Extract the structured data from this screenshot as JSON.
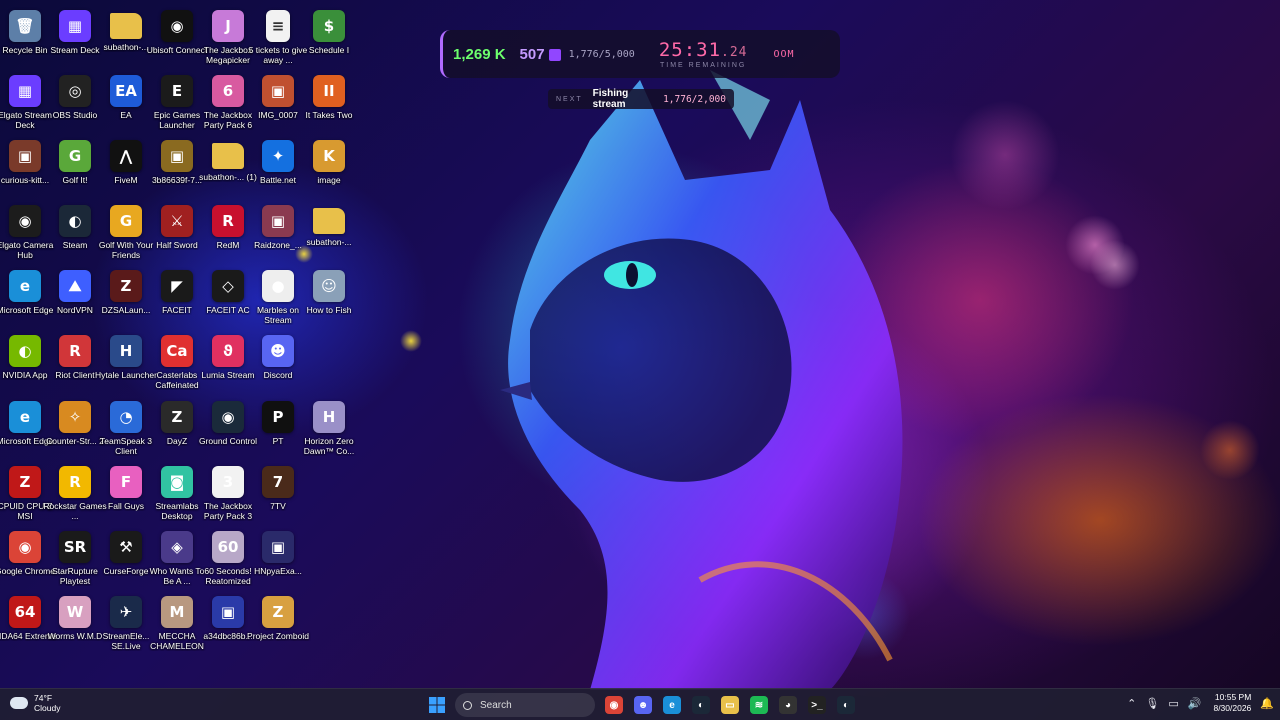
{
  "desktop": {
    "icons": [
      {
        "label": "Recycle Bin",
        "icon": "recycle-bin-icon",
        "color": "#5d7fa8",
        "glyph": "🗑"
      },
      {
        "label": "Stream Deck",
        "icon": "stream-deck-icon",
        "color": "#6b3dff",
        "glyph": "▦"
      },
      {
        "label": "subathon-...",
        "icon": "folder-icon",
        "color": "#e8c04a",
        "glyph": ""
      },
      {
        "label": "Ubisoft Connect",
        "icon": "ubisoft-icon",
        "color": "#111111",
        "glyph": "◉"
      },
      {
        "label": "The Jackbox Megapicker",
        "icon": "jackbox-icon",
        "color": "#c77ad8",
        "glyph": "J"
      },
      {
        "label": "5 tickets to give away ...",
        "icon": "text-file-icon",
        "color": "#f2f2f2",
        "glyph": "≡"
      },
      {
        "label": "Schedule I",
        "icon": "schedule-i-icon",
        "color": "#3a8f3a",
        "glyph": "$"
      },
      {
        "label": "Elgato Stream Deck",
        "icon": "stream-deck-icon",
        "color": "#6b3dff",
        "glyph": "▦"
      },
      {
        "label": "OBS Studio",
        "icon": "obs-icon",
        "color": "#222222",
        "glyph": "◎"
      },
      {
        "label": "EA",
        "icon": "ea-icon",
        "color": "#1e5bd8",
        "glyph": "EA"
      },
      {
        "label": "Epic Games Launcher",
        "icon": "epic-games-icon",
        "color": "#1b1b1b",
        "glyph": "E"
      },
      {
        "label": "The Jackbox Party Pack 6",
        "icon": "jackbox-icon",
        "color": "#d85aa0",
        "glyph": "6"
      },
      {
        "label": "IMG_0007",
        "icon": "image-icon",
        "color": "#c05030",
        "glyph": "▣"
      },
      {
        "label": "It Takes Two",
        "icon": "it-takes-two-icon",
        "color": "#e06020",
        "glyph": "ΙΙ"
      },
      {
        "label": "curious-kitt...",
        "icon": "image-icon",
        "color": "#7a3a2a",
        "glyph": "▣"
      },
      {
        "label": "Golf It!",
        "icon": "golf-it-icon",
        "color": "#5aa83a",
        "glyph": "G"
      },
      {
        "label": "FiveM",
        "icon": "fivem-icon",
        "color": "#111111",
        "glyph": "⋀"
      },
      {
        "label": "3b86639f-7...",
        "icon": "image-icon",
        "color": "#8a6a20",
        "glyph": "▣"
      },
      {
        "label": "subathon-... (1)",
        "icon": "folder-icon",
        "color": "#e8c04a",
        "glyph": ""
      },
      {
        "label": "Battle.net",
        "icon": "battle-net-icon",
        "color": "#1470e0",
        "glyph": "✦"
      },
      {
        "label": "image",
        "icon": "image-icon",
        "color": "#d89a30",
        "glyph": "K"
      },
      {
        "label": "Elgato Camera Hub",
        "icon": "camera-hub-icon",
        "color": "#1c1c1c",
        "glyph": "◉"
      },
      {
        "label": "Steam",
        "icon": "steam-icon",
        "color": "#1b2838",
        "glyph": "◐"
      },
      {
        "label": "Golf With Your Friends",
        "icon": "golf-friends-icon",
        "color": "#e8a820",
        "glyph": "G"
      },
      {
        "label": "Half Sword",
        "icon": "half-sword-icon",
        "color": "#a02020",
        "glyph": "⚔"
      },
      {
        "label": "RedM",
        "icon": "redm-icon",
        "color": "#c8102e",
        "glyph": "R"
      },
      {
        "label": "Raidzone_...",
        "icon": "image-icon",
        "color": "#8a3a50",
        "glyph": "▣"
      },
      {
        "label": "subathon-...",
        "icon": "folder-icon",
        "color": "#e8c04a",
        "glyph": ""
      },
      {
        "label": "Microsoft Edge",
        "icon": "edge-icon",
        "color": "#1a8fd8",
        "glyph": "e"
      },
      {
        "label": "NordVPN",
        "icon": "nordvpn-icon",
        "color": "#3e5fff",
        "glyph": "⛰"
      },
      {
        "label": "DZSALaun...",
        "icon": "dzsa-icon",
        "color": "#5a1a1a",
        "glyph": "Z"
      },
      {
        "label": "FACEIT",
        "icon": "faceit-icon",
        "color": "#1a1a1a",
        "glyph": "◤"
      },
      {
        "label": "FACEIT AC",
        "icon": "faceit-ac-icon",
        "color": "#1a1a1a",
        "glyph": "◇"
      },
      {
        "label": "Marbles on Stream",
        "icon": "marbles-icon",
        "color": "#eeeeee",
        "glyph": "●"
      },
      {
        "label": "How to Fish",
        "icon": "how-to-fish-icon",
        "color": "#8aa0b8",
        "glyph": "☺"
      },
      {
        "label": "NVIDIA App",
        "icon": "nvidia-icon",
        "color": "#76b900",
        "glyph": "◐"
      },
      {
        "label": "Riot Client",
        "icon": "riot-icon",
        "color": "#d13639",
        "glyph": "R"
      },
      {
        "label": "Hytale Launcher",
        "icon": "hytale-icon",
        "color": "#2a4a8a",
        "glyph": "H"
      },
      {
        "label": "Casterlabs Caffeinated",
        "icon": "casterlabs-icon",
        "color": "#e03030",
        "glyph": "Ca"
      },
      {
        "label": "Lumia Stream",
        "icon": "lumia-icon",
        "color": "#e03060",
        "glyph": "ϑ"
      },
      {
        "label": "Discord",
        "icon": "discord-icon",
        "color": "#5865f2",
        "glyph": "☻"
      },
      {
        "label": "Microsoft Edge",
        "icon": "edge-icon",
        "color": "#1a8fd8",
        "glyph": "e"
      },
      {
        "label": "Counter-Str... 2",
        "icon": "cs2-icon",
        "color": "#d88a20",
        "glyph": "✧"
      },
      {
        "label": "TeamSpeak 3 Client",
        "icon": "teamspeak-icon",
        "color": "#2a6ad8",
        "glyph": "◔"
      },
      {
        "label": "DayZ",
        "icon": "dayz-icon",
        "color": "#2a2a2a",
        "glyph": "Z"
      },
      {
        "label": "Ground Control",
        "icon": "ground-control-icon",
        "color": "#1a2a3a",
        "glyph": "◉"
      },
      {
        "label": "PT",
        "icon": "pt-icon",
        "color": "#101010",
        "glyph": "P"
      },
      {
        "label": "Horizon Zero Dawn™ Co...",
        "icon": "horizon-icon",
        "color": "#9a90c8",
        "glyph": "H"
      },
      {
        "label": "CPUID CPU-Z MSI",
        "icon": "cpuz-icon",
        "color": "#c01818",
        "glyph": "Z"
      },
      {
        "label": "Rockstar Games ...",
        "icon": "rockstar-icon",
        "color": "#f2b800",
        "glyph": "R"
      },
      {
        "label": "Fall Guys",
        "icon": "fall-guys-icon",
        "color": "#e860c0",
        "glyph": "F"
      },
      {
        "label": "Streamlabs Desktop",
        "icon": "streamlabs-icon",
        "color": "#31c3a2",
        "glyph": "◙"
      },
      {
        "label": "The Jackbox Party Pack 3",
        "icon": "jackbox-icon",
        "color": "#f2f2f2",
        "glyph": "3"
      },
      {
        "label": "7TV",
        "icon": "7tv-icon",
        "color": "#4a2a1a",
        "glyph": "7"
      },
      {
        "label": "Google Chrome",
        "icon": "chrome-icon",
        "color": "#db4437",
        "glyph": "◉"
      },
      {
        "label": "StarRupture Playtest",
        "icon": "starrupture-icon",
        "color": "#1a1a1a",
        "glyph": "SR"
      },
      {
        "label": "CurseForge",
        "icon": "curseforge-icon",
        "color": "#1a1a1a",
        "glyph": "⚒"
      },
      {
        "label": "Who Wants To Be A ...",
        "icon": "millionaire-icon",
        "color": "#4a3a8a",
        "glyph": "◈"
      },
      {
        "label": "60 Seconds! Reatomized",
        "icon": "sixty-seconds-icon",
        "color": "#b8a8c8",
        "glyph": "60"
      },
      {
        "label": "HNpyaExa...",
        "icon": "image-icon",
        "color": "#2a2a6a",
        "glyph": "▣"
      },
      {
        "label": "AIDA64 Extreme",
        "icon": "aida64-icon",
        "color": "#c01818",
        "glyph": "64"
      },
      {
        "label": "Worms W.M.D",
        "icon": "worms-icon",
        "color": "#d8a0c0",
        "glyph": "W"
      },
      {
        "label": "StreamEle... SE.Live",
        "icon": "streamelements-icon",
        "color": "#1a2a4a",
        "glyph": "✈"
      },
      {
        "label": "MECCHA CHAMELEON",
        "icon": "meccha-icon",
        "color": "#b89880",
        "glyph": "M"
      },
      {
        "label": "a34dbc86b...",
        "icon": "image-icon",
        "color": "#2a3aa8",
        "glyph": "▣"
      },
      {
        "label": "Project Zomboid",
        "icon": "zomboid-icon",
        "color": "#d8a040",
        "glyph": "Z"
      }
    ]
  },
  "overlay": {
    "viewers": "1,269 K",
    "subs": "507",
    "sub_goal": "1,776/5,000",
    "timer_main": "25:31",
    "timer_sub": ".24",
    "timer_label": "TIME REMAINING",
    "status": "OOM",
    "next_label": "NEXT",
    "next_goal": "Fishing stream",
    "next_progress": "1,776/2,000"
  },
  "taskbar": {
    "weather_temp": "74°F",
    "weather_desc": "Cloudy",
    "search_placeholder": "Search",
    "time": "10:55 PM",
    "date": "8/30/2026",
    "apps": [
      {
        "icon": "chrome-icon",
        "color": "#db4437",
        "glyph": "◉"
      },
      {
        "icon": "discord-icon",
        "color": "#5865f2",
        "glyph": "☻"
      },
      {
        "icon": "edge-icon",
        "color": "#1a8fd8",
        "glyph": "e"
      },
      {
        "icon": "steam-icon",
        "color": "#1b2838",
        "glyph": "◐"
      },
      {
        "icon": "file-explorer-icon",
        "color": "#e8c04a",
        "glyph": "▭"
      },
      {
        "icon": "spotify-icon",
        "color": "#1db954",
        "glyph": "≋"
      },
      {
        "icon": "github-icon",
        "color": "#333333",
        "glyph": "◕"
      },
      {
        "icon": "terminal-icon",
        "color": "#222222",
        "glyph": ">_"
      },
      {
        "icon": "steam-icon",
        "color": "#1b2838",
        "glyph": "◐"
      }
    ]
  }
}
